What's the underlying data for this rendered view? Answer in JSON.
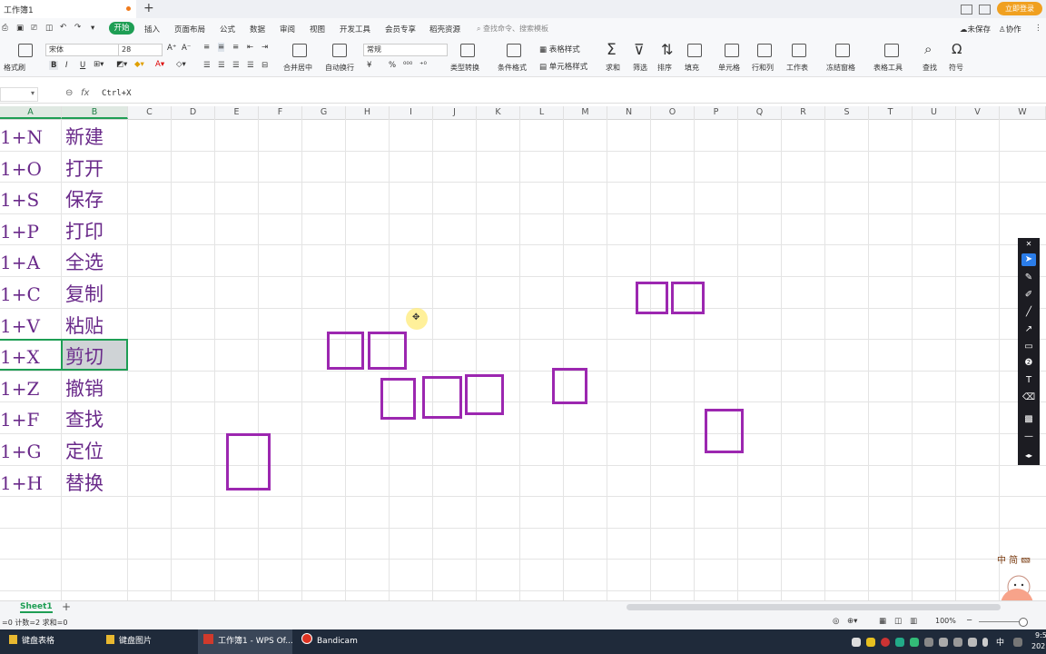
{
  "titlebar": {
    "doc_tab": "工作簿1",
    "new_tab": "+",
    "login_button": "立即登录"
  },
  "menu": {
    "items": [
      "开始",
      "插入",
      "页面布局",
      "公式",
      "数据",
      "审阅",
      "视图",
      "开发工具",
      "会员专享",
      "稻壳资源"
    ],
    "search_placeholder": "查找命令、搜索模板",
    "unsaved": "未保存",
    "collab": "协作"
  },
  "ribbon": {
    "format_painter": "格式刷",
    "font_name": "宋体",
    "font_size": "28",
    "bold": "B",
    "italic": "I",
    "underline": "U",
    "merge_center": "合并居中",
    "wrap_text": "自动换行",
    "number_format": "常规",
    "currency": "¥",
    "percent": "%",
    "type_convert": "类型转换",
    "conditional_format": "条件格式",
    "table_style": "表格样式",
    "cell_style": "单元格样式",
    "sum": "求和",
    "filter": "筛选",
    "sort": "排序",
    "fill": "填充",
    "cell": "单元格",
    "row_col": "行和列",
    "worksheet": "工作表",
    "freeze": "冻结窗格",
    "table_tools": "表格工具",
    "find": "查找",
    "symbol": "符号"
  },
  "formula_bar": {
    "fx": "fx",
    "content": "Ctrl+X"
  },
  "columns": [
    "A",
    "B",
    "C",
    "D",
    "E",
    "F",
    "G",
    "H",
    "I",
    "J",
    "K",
    "L",
    "M",
    "N",
    "O",
    "P",
    "Q",
    "R",
    "S",
    "T",
    "U",
    "V",
    "W"
  ],
  "rows": [
    {
      "a": "1+N",
      "b": "新建"
    },
    {
      "a": "1+O",
      "b": "打开"
    },
    {
      "a": "1+S",
      "b": "保存"
    },
    {
      "a": "1+P",
      "b": "打印"
    },
    {
      "a": "1+A",
      "b": "全选"
    },
    {
      "a": "1+C",
      "b": "复制"
    },
    {
      "a": "1+V",
      "b": "粘贴"
    },
    {
      "a": "1+X",
      "b": "剪切"
    },
    {
      "a": "1+Z",
      "b": "撤销"
    },
    {
      "a": "1+F",
      "b": "查找"
    },
    {
      "a": "1+G",
      "b": "定位"
    },
    {
      "a": "1+H",
      "b": "替换"
    }
  ],
  "sheet_bar": {
    "sheet_name": "Sheet1",
    "add_sheet": "+"
  },
  "status_bar": {
    "text": "=0  计数=2  求和=0",
    "zoom": "100%"
  },
  "taskbar": {
    "items": [
      "键盘表格",
      "键盘图片",
      "工作簿1 - WPS Of...",
      "Bandicam"
    ],
    "ime": "中",
    "clock_time": "9:5",
    "clock_date": "202"
  },
  "colors": {
    "accent": "#1e9e54",
    "annotation": "#9c27b0",
    "cell_text": "#6a2a8a"
  }
}
